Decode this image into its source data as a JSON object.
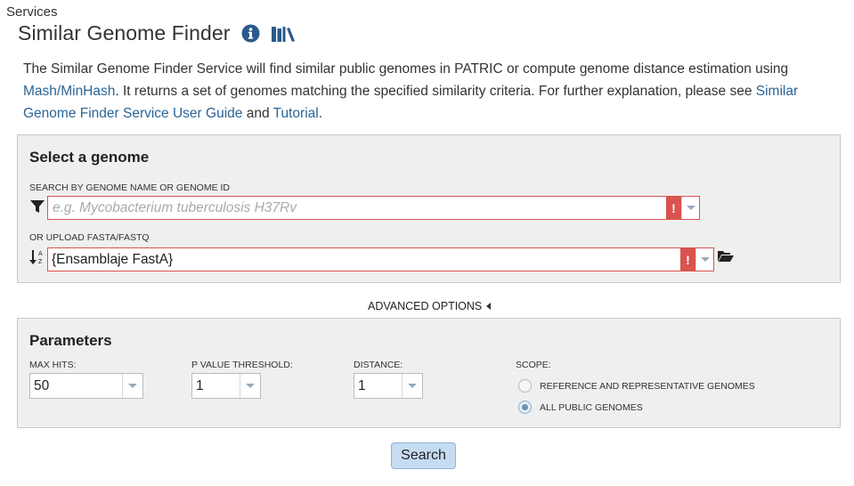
{
  "breadcrumb": "Services",
  "title": "Similar Genome Finder",
  "icons": {
    "info": "info-icon",
    "guide": "books-icon"
  },
  "intro": {
    "part1": "The Similar Genome Finder Service will find similar public genomes in PATRIC or compute genome distance estimation using ",
    "link_mash": "Mash/MinHash",
    "part2": ". It returns a set of genomes matching the specified similarity criteria. For further explanation, please see ",
    "link_guide": "Similar Genome Finder Service User Guide",
    "part3": " and ",
    "link_tutorial": "Tutorial",
    "part4": "."
  },
  "select_genome": {
    "heading": "Select a genome",
    "search_label": "SEARCH BY GENOME NAME OR GENOME ID",
    "search_placeholder": "e.g. Mycobacterium tuberculosis H37Rv",
    "upload_label": "OR UPLOAD FASTA/FASTQ",
    "upload_value": "{Ensamblaje FastA}",
    "error_mark": "!"
  },
  "advanced_options_label": "ADVANCED OPTIONS",
  "parameters": {
    "heading": "Parameters",
    "max_hits_label": "MAX HITS:",
    "max_hits_value": "50",
    "pvalue_label": "P VALUE THRESHOLD:",
    "pvalue_value": "1",
    "distance_label": "DISTANCE:",
    "distance_value": "1",
    "scope_label": "SCOPE:",
    "scope_options": [
      {
        "label": "REFERENCE AND REPRESENTATIVE GENOMES",
        "checked": false
      },
      {
        "label": "ALL PUBLIC GENOMES",
        "checked": true
      }
    ]
  },
  "search_button": "Search",
  "colors": {
    "link": "#2a6496",
    "error": "#d9534f",
    "button_bg": "#c6dcf3",
    "panel_bg": "#efefef"
  }
}
